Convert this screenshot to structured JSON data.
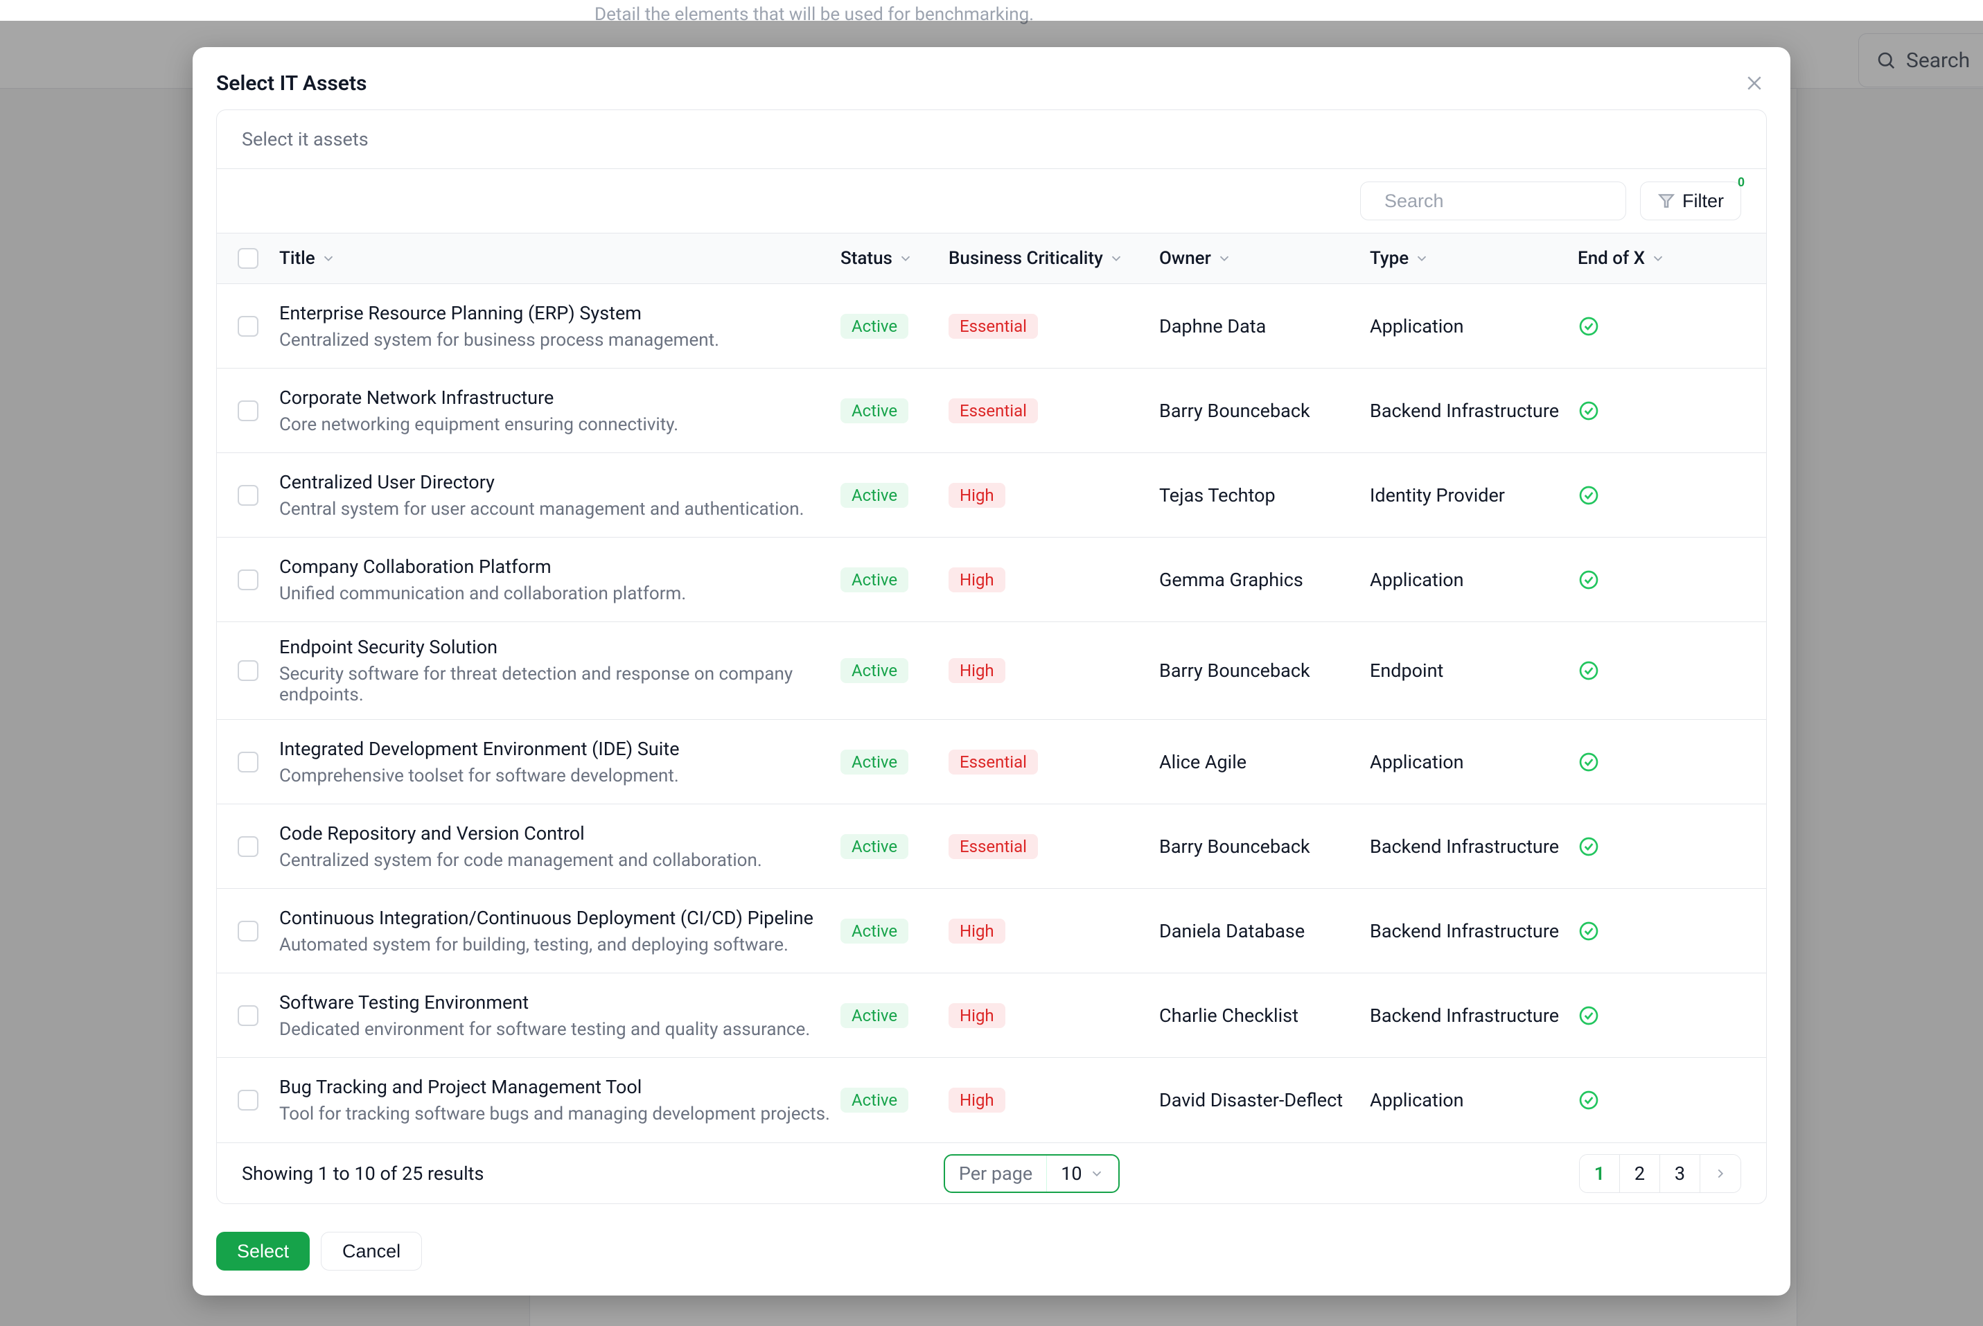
{
  "background": {
    "hint": "Detail the elements that will be used for benchmarking.",
    "search_placeholder": "Search"
  },
  "modal": {
    "title": "Select IT Assets",
    "subtitle": "Select it assets",
    "search_placeholder": "Search",
    "filter_label": "Filter",
    "filter_count": "0",
    "columns": {
      "title": "Title",
      "status": "Status",
      "criticality": "Business Criticality",
      "owner": "Owner",
      "type": "Type",
      "endx": "End of X"
    },
    "rows": [
      {
        "title": "Enterprise Resource Planning (ERP) System",
        "desc": "Centralized system for business process management.",
        "status": "Active",
        "criticality": "Essential",
        "owner": "Daphne Data",
        "type": "Application"
      },
      {
        "title": "Corporate Network Infrastructure",
        "desc": "Core networking equipment ensuring connectivity.",
        "status": "Active",
        "criticality": "Essential",
        "owner": "Barry Bounceback",
        "type": "Backend Infrastructure"
      },
      {
        "title": "Centralized User Directory",
        "desc": "Central system for user account management and authentication.",
        "status": "Active",
        "criticality": "High",
        "owner": "Tejas Techtop",
        "type": "Identity Provider"
      },
      {
        "title": "Company Collaboration Platform",
        "desc": "Unified communication and collaboration platform.",
        "status": "Active",
        "criticality": "High",
        "owner": "Gemma Graphics",
        "type": "Application"
      },
      {
        "title": "Endpoint Security Solution",
        "desc": "Security software for threat detection and response on company endpoints.",
        "status": "Active",
        "criticality": "High",
        "owner": "Barry Bounceback",
        "type": "Endpoint"
      },
      {
        "title": "Integrated Development Environment (IDE) Suite",
        "desc": "Comprehensive toolset for software development.",
        "status": "Active",
        "criticality": "Essential",
        "owner": "Alice Agile",
        "type": "Application"
      },
      {
        "title": "Code Repository and Version Control",
        "desc": "Centralized system for code management and collaboration.",
        "status": "Active",
        "criticality": "Essential",
        "owner": "Barry Bounceback",
        "type": "Backend Infrastructure"
      },
      {
        "title": "Continuous Integration/Continuous Deployment (CI/CD) Pipeline",
        "desc": "Automated system for building, testing, and deploying software.",
        "status": "Active",
        "criticality": "High",
        "owner": "Daniela Database",
        "type": "Backend Infrastructure"
      },
      {
        "title": "Software Testing Environment",
        "desc": "Dedicated environment for software testing and quality assurance.",
        "status": "Active",
        "criticality": "High",
        "owner": "Charlie Checklist",
        "type": "Backend Infrastructure"
      },
      {
        "title": "Bug Tracking and Project Management Tool",
        "desc": "Tool for tracking software bugs and managing development projects.",
        "status": "Active",
        "criticality": "High",
        "owner": "David Disaster-Deflect",
        "type": "Application"
      }
    ],
    "footer": {
      "results": "Showing 1 to 10 of 25 results",
      "per_page_label": "Per page",
      "per_page_value": "10",
      "pages": [
        "1",
        "2",
        "3"
      ],
      "active_page": "1"
    },
    "buttons": {
      "select": "Select",
      "cancel": "Cancel"
    }
  }
}
